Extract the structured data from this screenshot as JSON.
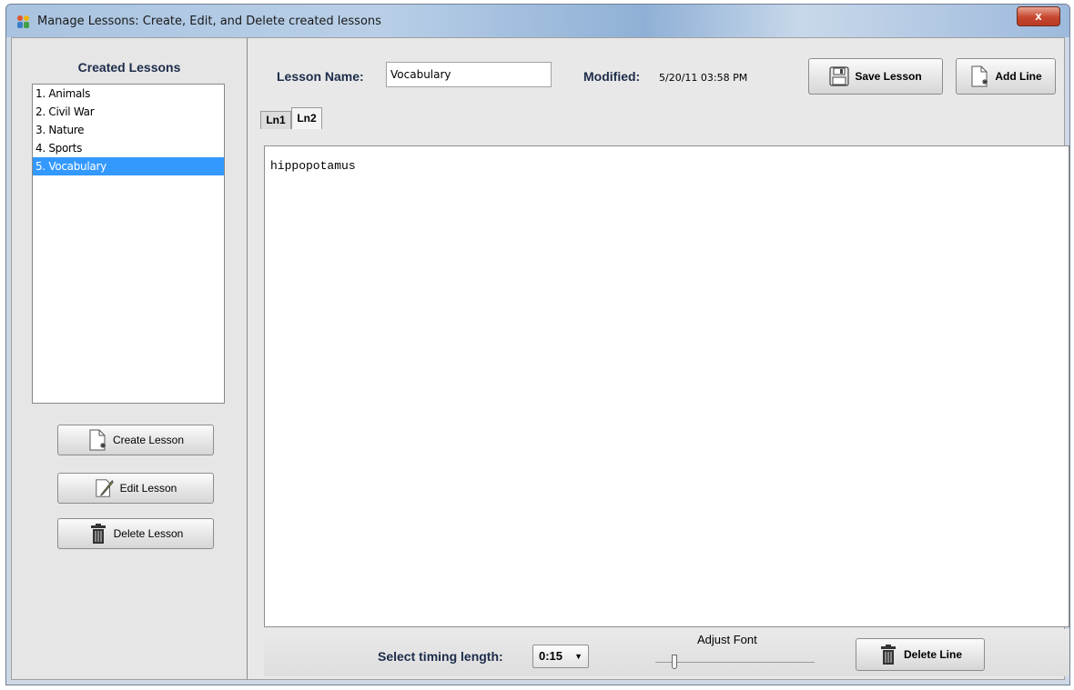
{
  "window": {
    "title": "Manage Lessons: Create, Edit, and Delete created lessons",
    "close_label": "x"
  },
  "sidebar": {
    "heading": "Created Lessons",
    "lessons": [
      {
        "label": "1. Animals",
        "selected": false
      },
      {
        "label": "2. Civil War",
        "selected": false
      },
      {
        "label": "3. Nature",
        "selected": false
      },
      {
        "label": "4. Sports",
        "selected": false
      },
      {
        "label": "5. Vocabulary",
        "selected": true
      }
    ],
    "create_label": "Create Lesson",
    "edit_label": "Edit Lesson",
    "delete_label": "Delete Lesson"
  },
  "header": {
    "name_label": "Lesson Name:",
    "name_value": "Vocabulary",
    "modified_label": "Modified:",
    "modified_value": "5/20/11 03:58 PM",
    "save_label": "Save Lesson",
    "add_line_label": "Add Line"
  },
  "tabs": [
    {
      "label": "Ln1",
      "active": false
    },
    {
      "label": "Ln2",
      "active": true
    }
  ],
  "editor": {
    "text": "hippopotamus"
  },
  "footer": {
    "timing_label": "Select timing length:",
    "timing_value": "0:15",
    "font_label": "Adjust Font",
    "font_level": 0.1,
    "delete_line_label": "Delete Line"
  },
  "colors": {
    "selection": "#3399ff",
    "heading_text": "#1c2c4a",
    "close_button": "#c6462e"
  },
  "icons": {
    "app": "app-people-icon",
    "save": "floppy-disk-icon",
    "new_document": "new-document-icon",
    "edit": "pencil-document-icon",
    "delete": "trash-can-icon"
  }
}
